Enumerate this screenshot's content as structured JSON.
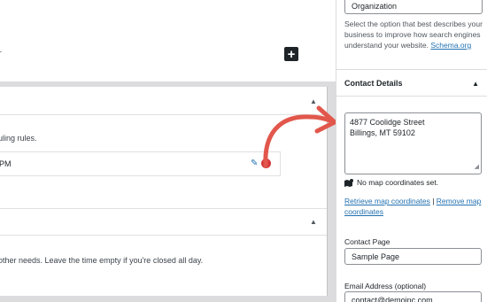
{
  "main": {
    "top_truncated_text": "r",
    "add_label": "+",
    "schedule": {
      "rules_text": "uling rules.",
      "row_time": "PM",
      "edit_icon": "pencil-icon",
      "delete_icon": "close-circle-icon",
      "other_needs_text": " other needs. Leave the time empty if you're closed all day."
    }
  },
  "sidebar": {
    "business_type_value": "Organization",
    "help_text": "Select the option that best describes your business to improve how search engines understand your website.",
    "help_link": "Schema.org",
    "contact_details_title": "Contact Details",
    "address_line1": "4877 Coolidge Street",
    "address_line2": "Billings, MT 59102",
    "map_status": "No map coordinates set.",
    "retrieve_link": "Retrieve map coordinates",
    "separator": " | ",
    "remove_link": "Remove map coordinates",
    "contact_page_label": "Contact Page",
    "contact_page_value": "Sample Page",
    "email_label": "Email Address (optional)",
    "email_value": "contact@demoinc.com"
  },
  "colors": {
    "accent": "#2271b1",
    "arrow": "#e2574c",
    "delete": "#d63638"
  }
}
